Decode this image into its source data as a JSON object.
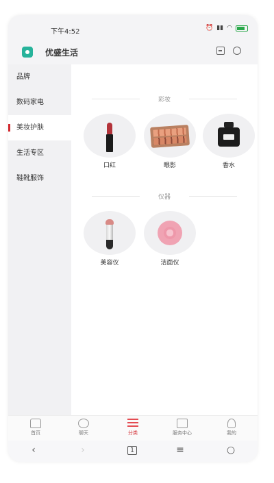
{
  "status_bar": {
    "time": "下午4:52",
    "icons": [
      "alarm-icon",
      "signal-icon",
      "wifi-icon",
      "battery-icon"
    ]
  },
  "header": {
    "title": "优盛生活",
    "right_icons": [
      "scan-icon",
      "circle-icon"
    ]
  },
  "sidebar": {
    "items": [
      {
        "label": "品牌",
        "active": false
      },
      {
        "label": "数码家电",
        "active": false
      },
      {
        "label": "美妆护肤",
        "active": true
      },
      {
        "label": "生活专区",
        "active": false
      },
      {
        "label": "鞋靴服饰",
        "active": false
      }
    ]
  },
  "content": {
    "sections": [
      {
        "title": "彩妆",
        "items": [
          {
            "label": "口红"
          },
          {
            "label": "眼影"
          },
          {
            "label": "香水"
          }
        ]
      },
      {
        "title": "仪器",
        "items": [
          {
            "label": "美容仪"
          },
          {
            "label": "洁面仪"
          }
        ]
      }
    ]
  },
  "tabbar": {
    "items": [
      {
        "label": "首页",
        "icon": "home-icon",
        "active": false
      },
      {
        "label": "聊天",
        "icon": "chat-icon",
        "active": false
      },
      {
        "label": "分类",
        "icon": "category-icon",
        "active": true
      },
      {
        "label": "服务中心",
        "icon": "service-icon",
        "active": false
      },
      {
        "label": "我的",
        "icon": "profile-icon",
        "active": false
      }
    ]
  },
  "navbar": {
    "back": "‹",
    "forward": "›",
    "tabs_count": "1",
    "menu": "≡",
    "home": "○"
  },
  "colors": {
    "accent": "#d2282e",
    "logo": "#27b39b"
  }
}
